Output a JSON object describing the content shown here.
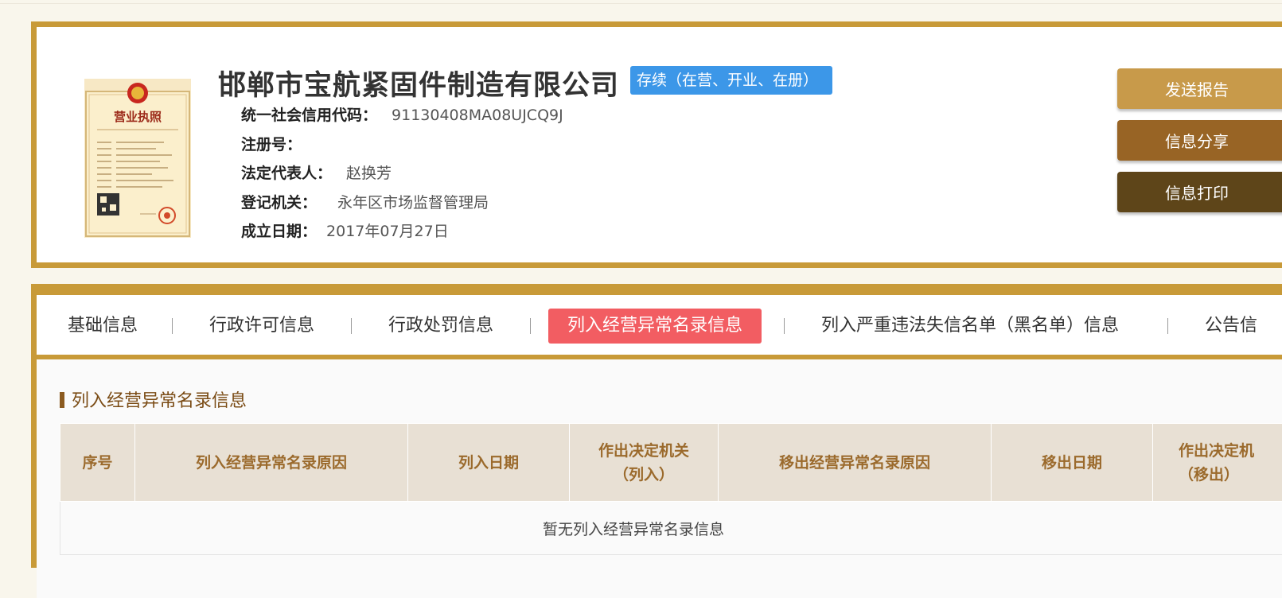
{
  "company": {
    "name": "邯郸市宝航紧固件制造有限公司",
    "status": "存续（在营、开业、在册）",
    "license_image": {
      "title": "营业执照",
      "icon": "business-license-image"
    }
  },
  "info": [
    {
      "label": "统一社会信用代码：",
      "value": "91130408MA08UJCQ9J"
    },
    {
      "label": "注册号：",
      "value": ""
    },
    {
      "label": "法定代表人：",
      "value": "赵换芳"
    },
    {
      "label": "登记机关：",
      "value": "永年区市场监督管理局"
    },
    {
      "label": "成立日期：",
      "value": "2017年07月27日"
    }
  ],
  "actions": {
    "send": "发送报告",
    "share": "信息分享",
    "print": "信息打印"
  },
  "tabs": [
    {
      "label": "基础信息"
    },
    {
      "label": "行政许可信息"
    },
    {
      "label": "行政处罚信息"
    },
    {
      "label": "列入经营异常名录信息",
      "active": true
    },
    {
      "label": "列入严重违法失信名单（黑名单）信息"
    },
    {
      "label": "公告信"
    }
  ],
  "section": {
    "title": "列入经营异常名录信息",
    "columns": [
      "序号",
      "列入经营异常名录原因",
      "列入日期",
      "作出决定机关\n（列入）",
      "移出经营异常名录原因",
      "移出日期",
      "作出决定机\n（移出）"
    ],
    "empty_message": "暂无列入经营异常名录信息"
  },
  "colors": {
    "gold_border": "#c89a38",
    "status_blue": "#3c97e8",
    "active_tab": "#f25d62",
    "btn_send": "#c89a4a",
    "btn_share": "#986425",
    "btn_print": "#5e4519",
    "header_text": "#9b6a2c"
  }
}
